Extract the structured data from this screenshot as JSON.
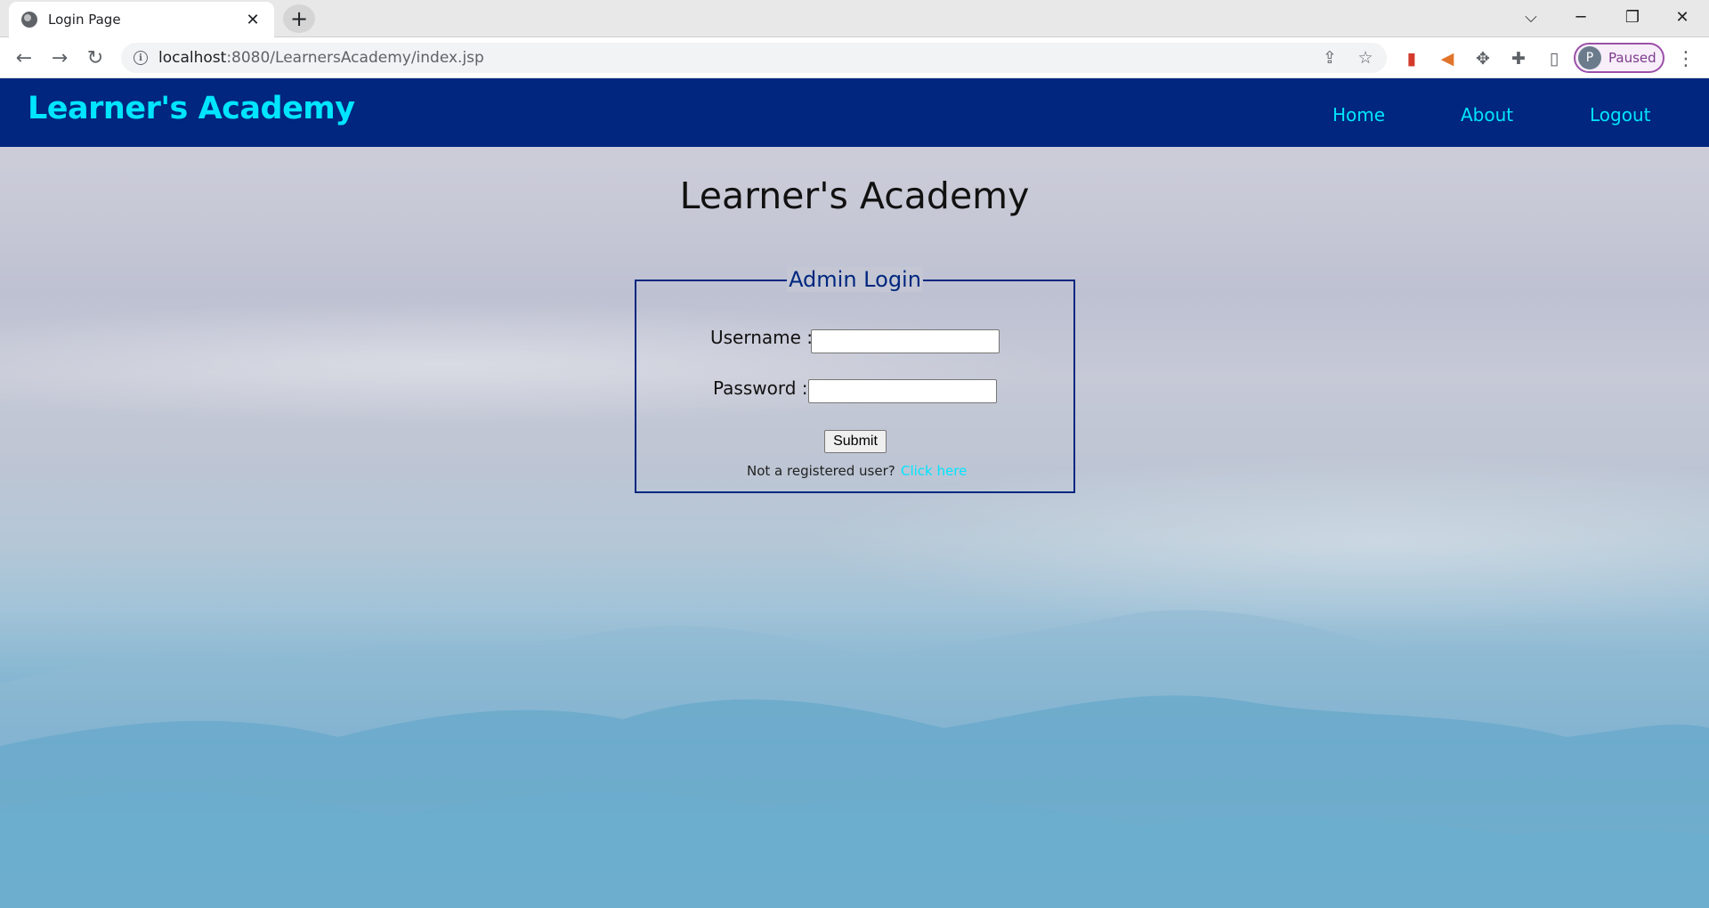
{
  "browser": {
    "tab_title": "Login Page",
    "tab_close": "✕",
    "new_tab": "+",
    "url_host": "localhost",
    "url_rest": ":8080/LearnersAcademy/index.jsp",
    "profile_initial": "P",
    "profile_status": "Paused"
  },
  "nav": {
    "brand": "Learner's Academy",
    "links": [
      "Home",
      "About",
      "Logout"
    ]
  },
  "main": {
    "heading": "Learner's Academy",
    "login": {
      "legend": "Admin Login",
      "username_label": "Username :",
      "password_label": "Password :",
      "username_value": "",
      "password_value": "",
      "submit_label": "Submit",
      "register_prompt": "Not a registered user?",
      "register_link": "Click here"
    }
  },
  "colors": {
    "navbar": "#00267f",
    "accent": "#00e5ff",
    "fieldset_border": "#00267f"
  }
}
